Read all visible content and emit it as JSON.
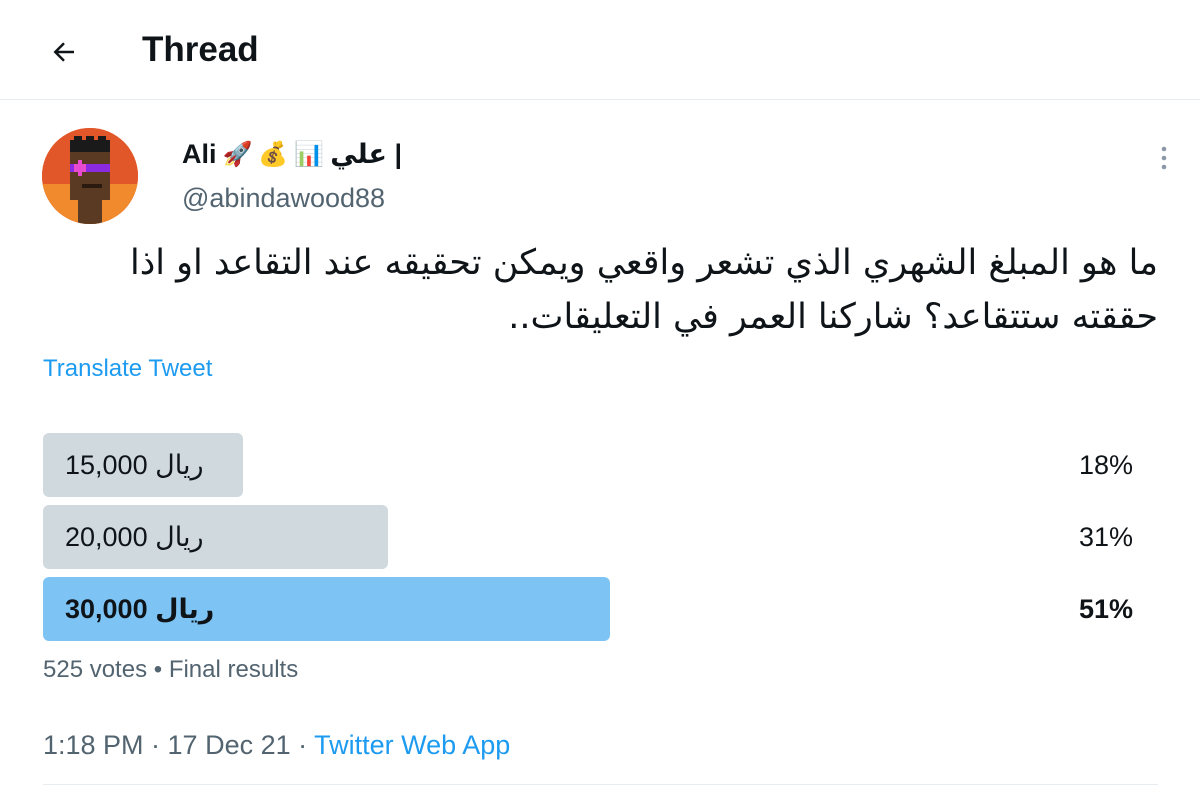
{
  "header": {
    "title": "Thread",
    "back_icon": "arrow-left-icon"
  },
  "author": {
    "name": "Ali",
    "name_emojis": [
      "🚀",
      "💰",
      "📊"
    ],
    "name_suffix": "| علي",
    "handle": "@abindawood88",
    "avatar": "pixel-punk-avatar"
  },
  "tweet": {
    "text": "ما هو المبلغ الشهري الذي تشعر واقعي ويمكن تحقيقه عند التقاعد او اذا حققته ستتقاعد؟ شاركنا العمر في التعليقات..",
    "translate_label": "Translate Tweet"
  },
  "poll": {
    "options": [
      {
        "label": "15,000 ريال",
        "percent_label": "18%",
        "percent": 18,
        "winner": false
      },
      {
        "label": "20,000 ريال",
        "percent_label": "31%",
        "percent": 31,
        "winner": false
      },
      {
        "label": "30,000 ريال",
        "percent_label": "51%",
        "percent": 51,
        "winner": true
      }
    ],
    "meta": "525 votes • Final results"
  },
  "meta": {
    "time": "1:18 PM · 17 Dec 21 · ",
    "source": "Twitter Web App"
  },
  "colors": {
    "accent": "#1d9bf0",
    "poll_bar": "#cfd9de",
    "poll_winner": "#7dc4f5",
    "secondary_text": "#536471"
  }
}
